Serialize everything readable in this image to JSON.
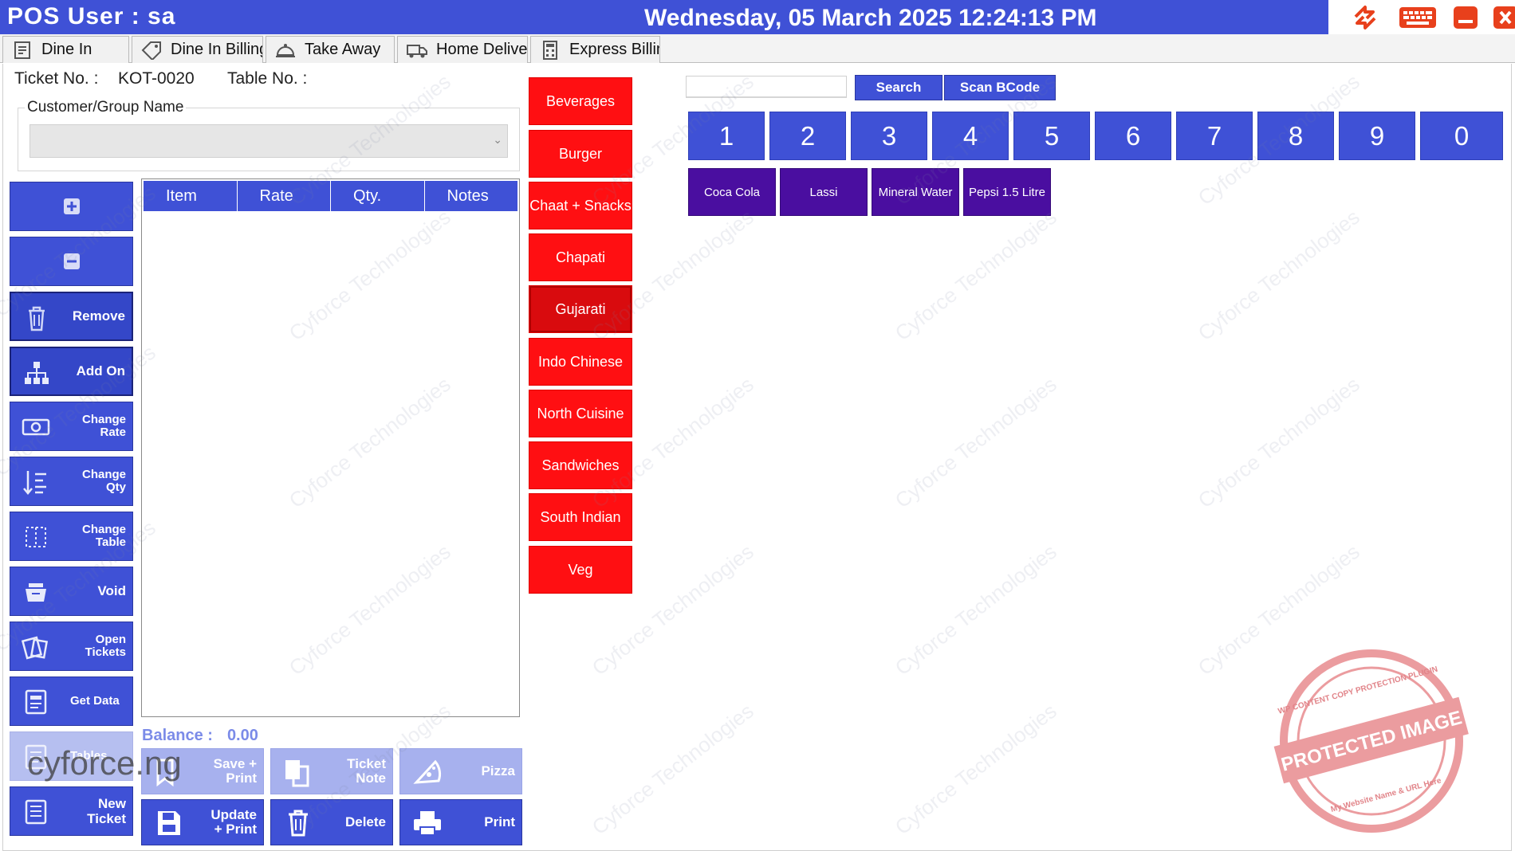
{
  "titlebar": {
    "app_label": "POS  User :  sa",
    "datetime": "Wednesday, 05 March 2025 12:24:13 PM",
    "icons": [
      "refresh-icon",
      "keyboard-icon",
      "minimize-icon",
      "close-icon"
    ],
    "colors": {
      "bar": "#3f51d6",
      "icon": "#e8401c"
    }
  },
  "tabs": [
    {
      "label": "Dine In",
      "icon": "receipt-icon"
    },
    {
      "label": "Dine In Billing",
      "icon": "tag-icon"
    },
    {
      "label": "Take Away",
      "icon": "cloche-icon"
    },
    {
      "label": "Home Delivery",
      "icon": "truck-icon"
    },
    {
      "label": "Express Billing",
      "icon": "calculator-icon"
    }
  ],
  "ticket": {
    "ticket_label": "Ticket No. :",
    "ticket_no": "KOT-0020",
    "table_label": "Table No. :",
    "customer_caption": "Customer/Group Name",
    "customer_value": ""
  },
  "actions": [
    {
      "label": "",
      "icon": "plus-icon"
    },
    {
      "label": "",
      "icon": "minus-icon"
    },
    {
      "label": "Remove",
      "icon": "trash-icon"
    },
    {
      "label": "Add On",
      "icon": "hierarchy-icon"
    },
    {
      "label": "Change Rate",
      "icon": "money-icon"
    },
    {
      "label": "Change Qty",
      "icon": "sort-icon"
    },
    {
      "label": "Change Table",
      "icon": "table-grid-icon"
    },
    {
      "label": "Void",
      "icon": "inbox-icon"
    },
    {
      "label": "Open Tickets",
      "icon": "tickets-icon"
    },
    {
      "label": "Get Data",
      "icon": "data-icon"
    },
    {
      "label": "Tables",
      "icon": "tables-icon"
    },
    {
      "label": "New Ticket",
      "icon": "new-ticket-icon"
    }
  ],
  "grid": {
    "columns": [
      "Item",
      "Rate",
      "Qty.",
      "Notes"
    ],
    "rows": []
  },
  "balance": {
    "label": "Balance :",
    "value": "0.00"
  },
  "bottom_buttons": [
    {
      "label": "Save + Print",
      "icon": "save-print-icon"
    },
    {
      "label": "Ticket Note",
      "icon": "note-icon"
    },
    {
      "label": "Pizza",
      "icon": "pizza-icon"
    },
    {
      "label": "Update + Print",
      "icon": "floppy-icon"
    },
    {
      "label": "Delete",
      "icon": "trash-icon"
    },
    {
      "label": "Print",
      "icon": "printer-icon"
    }
  ],
  "categories": [
    "Beverages",
    "Burger",
    "Chaat + Snacks",
    "Chapati",
    "Gujarati",
    "Indo Chinese",
    "North Cuisine",
    "Sandwiches",
    "South Indian",
    "Veg"
  ],
  "search": {
    "value": "",
    "search_label": "Search",
    "scan_label": "Scan BCode"
  },
  "numpad": [
    "1",
    "2",
    "3",
    "4",
    "5",
    "6",
    "7",
    "8",
    "9",
    "0"
  ],
  "items": [
    "Coca Cola",
    "Lassi",
    "Mineral Water",
    "Pepsi 1.5 Litre"
  ],
  "watermark": {
    "text": "Cyforce Technologies",
    "brand": "cyforce.ng",
    "stamp_text": "PROTECTED IMAGE",
    "stamp_ring": "WP CONTENT COPY PROTECTION PLUGIN",
    "stamp_sub": "My Website Name & URL Here"
  },
  "colors": {
    "primary": "#3f51d6",
    "category": "#ff0f12",
    "item": "#4a0ea0",
    "balance": "#7b8be8"
  }
}
